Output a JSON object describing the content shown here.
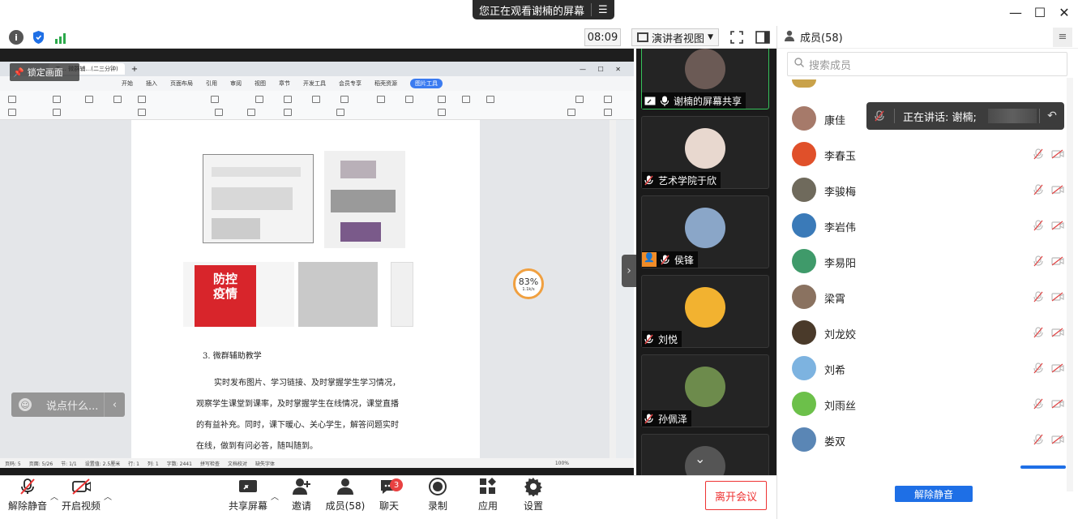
{
  "window": {
    "banner_text": "您正在观看谢楠的屏幕",
    "minimize_icon": "minimize-icon",
    "maximize_icon": "maximize-icon",
    "close_icon": "close-icon"
  },
  "meeting_toolbar": {
    "timer": "08:09",
    "view_label": "演讲者视图",
    "lock_label": "锁定画面",
    "chat_placeholder": "说点什么...",
    "progress_value": "83%",
    "progress_speed": "1.1k/s"
  },
  "document": {
    "tab_title": "工…  微群辅…(二三分钟)",
    "menu": [
      "开始",
      "插入",
      "页面布局",
      "引用",
      "审阅",
      "视图",
      "章节",
      "开发工具",
      "会员专享",
      "稻壳资源",
      "图片工具"
    ],
    "heading": "3.    微群辅助教学",
    "paragraph_lines": [
      "实时发布图片、学习链接、及时掌握学生学习情况，",
      "观察学生课堂到课率，及时掌握学生在线情况，课堂直播",
      "的有益补充。同时，课下暖心、关心学生，解答问题实时",
      "在线，做到有问必答，随叫随到。"
    ],
    "status": [
      "页码: 5",
      "页面: 5/26",
      "节: 1/1",
      "设置值: 2.5厘米",
      "行: 1",
      "列: 1",
      "字数: 2441",
      "拼写检查",
      "文档校对",
      "缺失字体"
    ],
    "zoom": "100%",
    "poster_text": [
      "防控",
      "疫情"
    ]
  },
  "videos": [
    {
      "name": "谢楠的屏幕共享",
      "active": true,
      "muted": false,
      "screen_icon": true,
      "color": "#6b5a55"
    },
    {
      "name": "艺术学院于欣",
      "active": false,
      "muted": true,
      "color": "#e8d8cf"
    },
    {
      "name": "侯锋",
      "active": false,
      "muted": true,
      "host_icon": true,
      "color": "#8aa6c8"
    },
    {
      "name": "刘悦",
      "active": false,
      "muted": true,
      "color": "#f2b230"
    },
    {
      "name": "孙佩泽",
      "active": false,
      "muted": true,
      "color": "#6d8b4c"
    },
    {
      "name": "",
      "active": false,
      "muted": false,
      "color": "#555"
    }
  ],
  "bottom_toolbar": {
    "unmute": "解除静音",
    "start_video": "开启视频",
    "share_screen": "共享屏幕",
    "invite": "邀请",
    "members": "成员(58)",
    "chat": "聊天",
    "chat_badge": "3",
    "record": "录制",
    "apps": "应用",
    "settings": "设置",
    "leave": "离开会议"
  },
  "members_panel": {
    "title": "成员(58)",
    "search_placeholder": "搜索成员",
    "speaking_label": "正在讲话: 谢楠;",
    "unmute_all": "解除静音",
    "members": [
      {
        "name": "康佳",
        "color": "#a67a6a"
      },
      {
        "name": "李春玉",
        "color": "#e0502a"
      },
      {
        "name": "李骏梅",
        "color": "#6f6a5c"
      },
      {
        "name": "李岩伟",
        "color": "#3a7ab8"
      },
      {
        "name": "李易阳",
        "color": "#3f9a6a"
      },
      {
        "name": "梁霄",
        "color": "#8a7260"
      },
      {
        "name": "刘龙姣",
        "color": "#4a3a2a"
      },
      {
        "name": "刘希",
        "color": "#7db3e0"
      },
      {
        "name": "刘雨丝",
        "color": "#6cc04a"
      },
      {
        "name": "娄双",
        "color": "#5a86b5"
      }
    ]
  },
  "colors": {
    "accent_blue": "#1e6fe6",
    "leave_red": "#e33333",
    "active_green": "#36c25a",
    "muted_red": "#e04646"
  }
}
